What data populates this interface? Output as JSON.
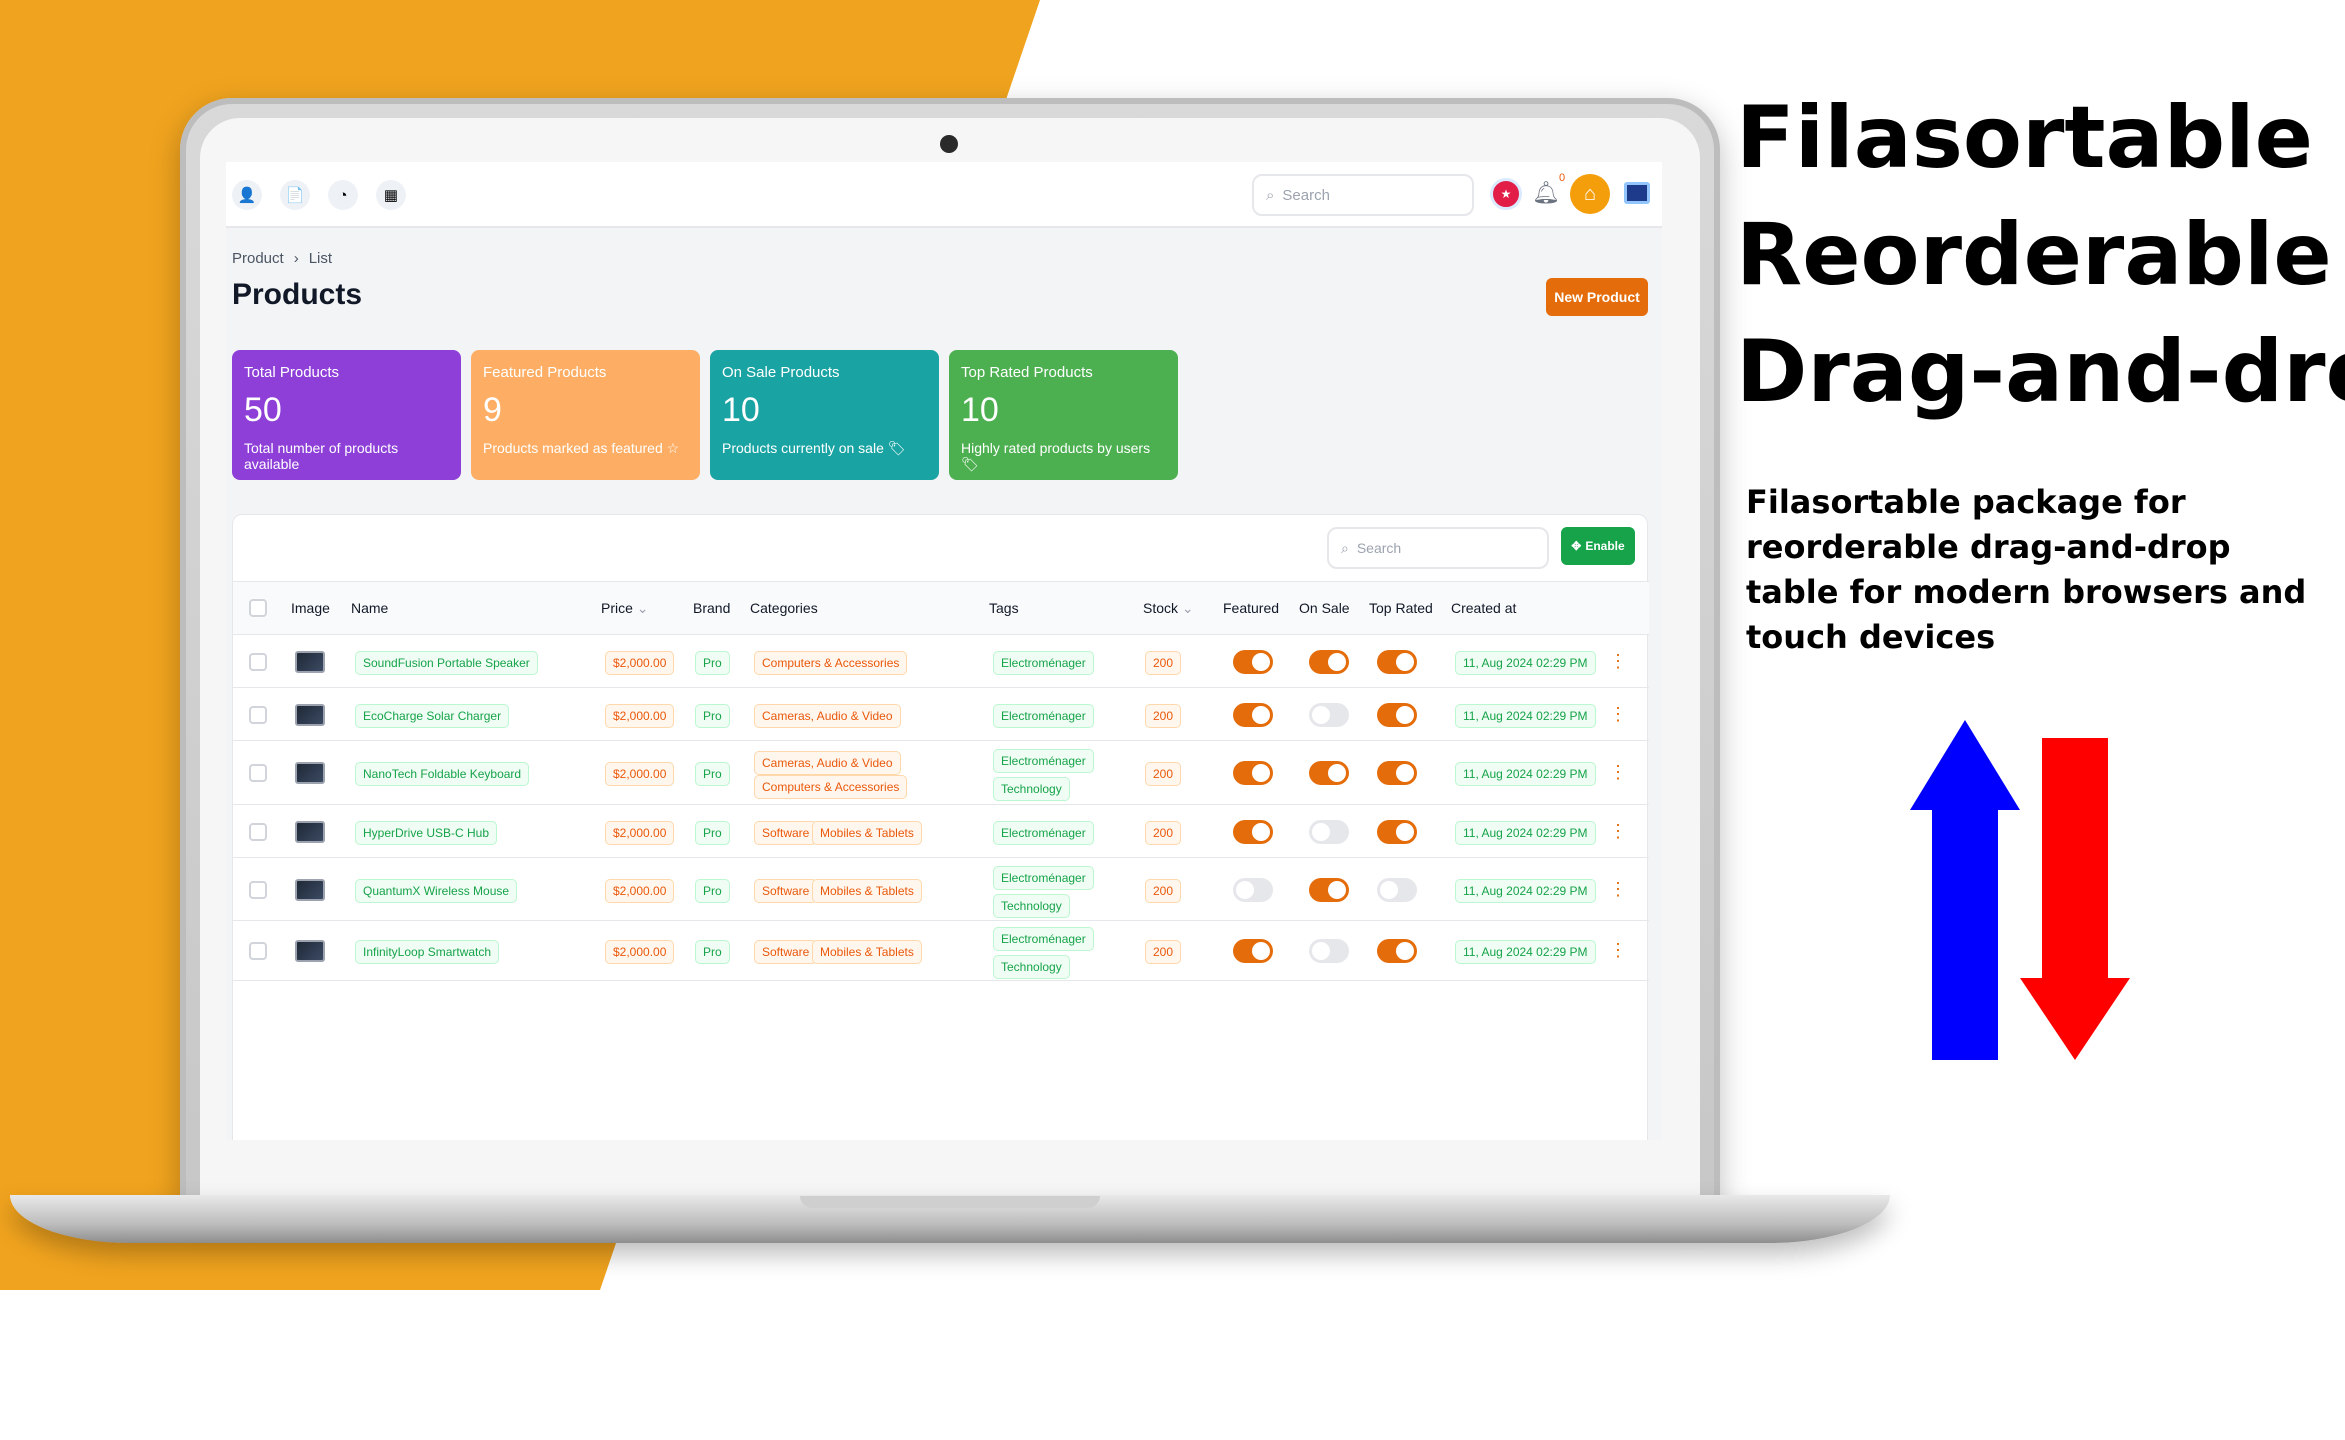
{
  "colors": {
    "orange_bg": "#f0a31e",
    "arrow_up": "#0000ff",
    "arrow_down": "#ff0000",
    "accent": "#e46c0a"
  },
  "hero": {
    "line1": "Filasortable",
    "line2": "Reorderable",
    "line3": "Drag-and-drop",
    "subtitle": "Filasortable package for reorderable drag-and-drop table for modern browsers and touch devices"
  },
  "topbar": {
    "search_placeholder": "Search",
    "notif_count": "0",
    "icons": [
      "user-icon",
      "document-icon",
      "chart-icon",
      "calendar-icon"
    ]
  },
  "breadcrumb": [
    "Product",
    "List"
  ],
  "page_title": "Products",
  "new_button": "New Product",
  "stats": [
    {
      "label": "Total Products",
      "value": "50",
      "desc": "Total number of products available",
      "color": "#8e3fd8"
    },
    {
      "label": "Featured Products",
      "value": "9",
      "desc": "Products marked as featured",
      "color": "#fdae64"
    },
    {
      "label": "On Sale Products",
      "value": "10",
      "desc": "Products currently on sale",
      "color": "#1aa3a3"
    },
    {
      "label": "Top Rated Products",
      "value": "10",
      "desc": "Highly rated products by users",
      "color": "#4caf50"
    }
  ],
  "table": {
    "search_placeholder": "Search",
    "enable_label": "Enable",
    "headers": {
      "image": "Image",
      "name": "Name",
      "price": "Price",
      "brand": "Brand",
      "categories": "Categories",
      "tags": "Tags",
      "stock": "Stock",
      "featured": "Featured",
      "on_sale": "On Sale",
      "top_rated": "Top Rated",
      "created": "Created at"
    },
    "rows": [
      {
        "name": "SoundFusion Portable Speaker",
        "price": "$2,000.00",
        "brand": "Pro",
        "categories": [
          "Computers & Accessories"
        ],
        "tags": [
          "Electroménager"
        ],
        "stock": "200",
        "featured": true,
        "on_sale": true,
        "top_rated": true,
        "created": "11, Aug 2024 02:29 PM"
      },
      {
        "name": "EcoCharge Solar Charger",
        "price": "$2,000.00",
        "brand": "Pro",
        "categories": [
          "Cameras, Audio & Video"
        ],
        "tags": [
          "Electroménager"
        ],
        "stock": "200",
        "featured": true,
        "on_sale": false,
        "top_rated": true,
        "created": "11, Aug 2024 02:29 PM"
      },
      {
        "name": "NanoTech Foldable Keyboard",
        "price": "$2,000.00",
        "brand": "Pro",
        "categories": [
          "Cameras, Audio & Video",
          "Computers & Accessories"
        ],
        "tags": [
          "Electroménager",
          "Technology"
        ],
        "stock": "200",
        "featured": true,
        "on_sale": true,
        "top_rated": true,
        "created": "11, Aug 2024 02:29 PM"
      },
      {
        "name": "HyperDrive USB-C Hub",
        "price": "$2,000.00",
        "brand": "Pro",
        "categories": [
          "Software",
          "Mobiles & Tablets"
        ],
        "tags": [
          "Electroménager"
        ],
        "stock": "200",
        "featured": true,
        "on_sale": false,
        "top_rated": true,
        "created": "11, Aug 2024 02:29 PM"
      },
      {
        "name": "QuantumX Wireless Mouse",
        "price": "$2,000.00",
        "brand": "Pro",
        "categories": [
          "Software",
          "Mobiles & Tablets"
        ],
        "tags": [
          "Electroménager",
          "Technology"
        ],
        "stock": "200",
        "featured": false,
        "on_sale": true,
        "top_rated": false,
        "created": "11, Aug 2024 02:29 PM"
      },
      {
        "name": "InfinityLoop Smartwatch",
        "price": "$2,000.00",
        "brand": "Pro",
        "categories": [
          "Software",
          "Mobiles & Tablets"
        ],
        "tags": [
          "Electroménager",
          "Technology"
        ],
        "stock": "200",
        "featured": true,
        "on_sale": false,
        "top_rated": true,
        "created": "11, Aug 2024 02:29 PM"
      }
    ]
  }
}
